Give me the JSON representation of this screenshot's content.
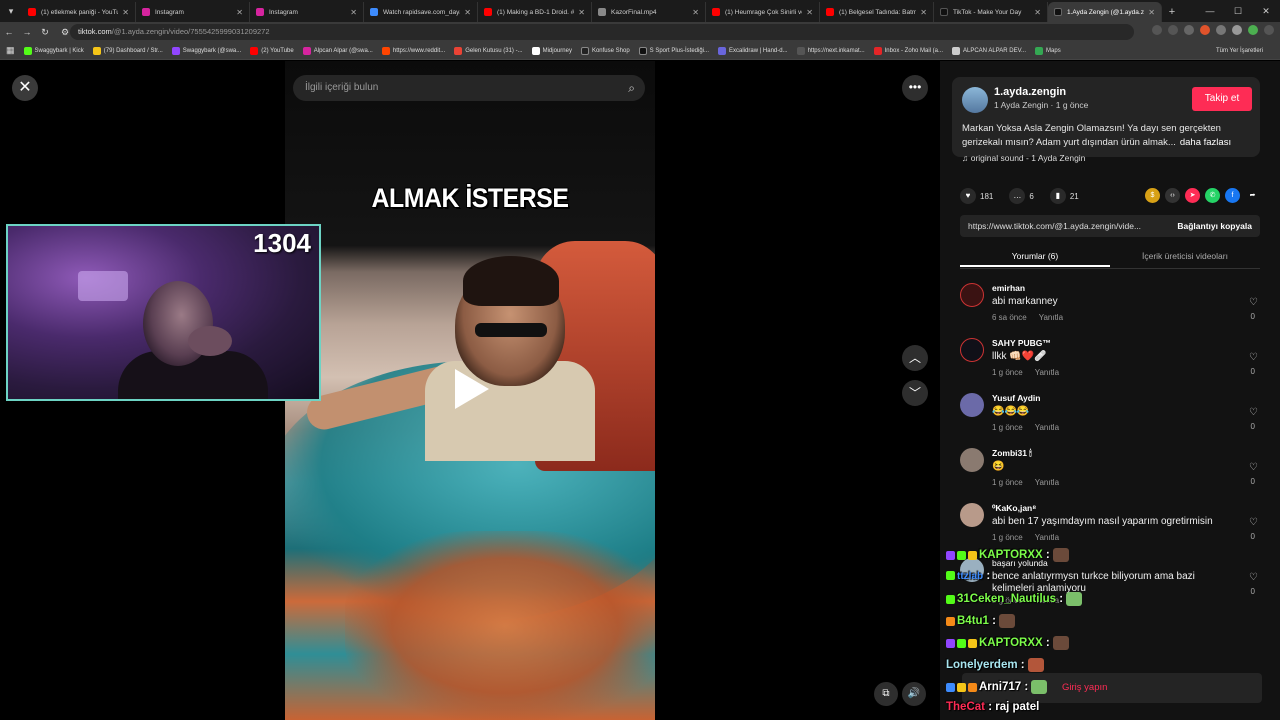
{
  "browser": {
    "tabs": [
      {
        "label": "(1) etlekmek paniği - YouTube",
        "color": "#ff0000",
        "active": false
      },
      {
        "label": "Instagram",
        "color": "#d6249f",
        "active": false
      },
      {
        "label": "Instagram",
        "color": "#d6249f",
        "active": false
      },
      {
        "label": "Watch rapidsave.com_dayanı...",
        "color": "#3d8bfd",
        "active": false
      },
      {
        "label": "(1) Making a BD-1 Droid. #sh...",
        "color": "#ff0000",
        "active": false
      },
      {
        "label": "KazorFinal.mp4",
        "color": "#888888",
        "active": false
      },
      {
        "label": "(1) Heumrage Çok Sinirli ve O...",
        "color": "#ff0000",
        "active": false
      },
      {
        "label": "(1) Belgesel Tadında: Batman...",
        "color": "#ff0000",
        "active": false
      },
      {
        "label": "TikTok - Make Your Day",
        "color": "#111111",
        "active": false
      },
      {
        "label": "1.Ayda Zengin (@1.ayda.zeng...",
        "color": "#111111",
        "active": true
      }
    ],
    "url_host": "tiktok.com",
    "url_path": "/@1.ayda.zengin/video/7555425999031209272",
    "bookmarks": [
      {
        "label": "Swaggybark | Kick",
        "color": "#53fc18"
      },
      {
        "label": "(79) Dashboard / Str...",
        "color": "#f5c518"
      },
      {
        "label": "Swaggybark (@swa...",
        "color": "#9146ff"
      },
      {
        "label": "(2) YouTube",
        "color": "#ff0000"
      },
      {
        "label": "Alpcan Alpar (@swa...",
        "color": "#d6249f"
      },
      {
        "label": "https://www.reddit...",
        "color": "#ff4500"
      },
      {
        "label": "Gelen Kutusu (31) -...",
        "color": "#ea4335"
      },
      {
        "label": "Midjourney",
        "color": "#ffffff"
      },
      {
        "label": "Konfuse Shop",
        "color": "#222222"
      },
      {
        "label": "S Sport Plus-İstediği...",
        "color": "#111111"
      },
      {
        "label": "Excalidraw | Hand-d...",
        "color": "#6965db"
      },
      {
        "label": "https://next.inkamat...",
        "color": "#555555"
      },
      {
        "label": "Inbox - Zoho Mail (a...",
        "color": "#e42527"
      },
      {
        "label": "ALPCAN ALPAR DEV...",
        "color": "#cccccc"
      },
      {
        "label": "Maps",
        "color": "#34a853"
      }
    ],
    "bookmarks_right": "Tüm Yer İşaretleri"
  },
  "video": {
    "search_placeholder": "İlgili içeriği bulun",
    "caption": "ALMAK İSTERSE"
  },
  "webcam": {
    "counter": "1304"
  },
  "info": {
    "username": "1.ayda.zengin",
    "subline": "1 Ayda Zengin · 1 g önce",
    "follow": "Takip et",
    "description": "Markan Yoksa Asla Zengin Olamazsın! Ya dayı sen gerçekten gerizekalı mısın? Adam yurt dışından ürün almak...",
    "more": "daha fazlası",
    "sound": "♫  original sound - 1 Ayda Zengin",
    "likes": "181",
    "comments": "6",
    "saves": "21",
    "link": "https://www.tiktok.com/@1.ayda.zengin/vide...",
    "copy_link": "Bağlantıyı kopyala",
    "tab_comments": "Yorumlar (6)",
    "tab_creator": "İçerik üreticisi videoları"
  },
  "comments": [
    {
      "name": "emirhan",
      "text": "abi markanney",
      "time": "6 sa önce",
      "reply": "Yanıtla",
      "likes": "0",
      "avatar": "#3a1212"
    },
    {
      "name": "SAHY PUBG™",
      "text": "llkk 👊🏻❤️🩹",
      "time": "1 g önce",
      "reply": "Yanıtla",
      "likes": "0",
      "avatar": "#101018"
    },
    {
      "name": "Yusuf Aydin",
      "text": "😂😂😂",
      "time": "1 g önce",
      "reply": "Yanıtla",
      "likes": "0",
      "avatar": "#6b6aa8"
    },
    {
      "name": "Zombi31 🕯",
      "text": "😆",
      "time": "1 g önce",
      "reply": "Yanıtla",
      "likes": "0",
      "avatar": "#8a7a70"
    },
    {
      "name": "⁰KaKo,jan⁸",
      "text": "abi ben 17 yaşımdayım nasıl yaparım ogretirmisin",
      "time": "1 g önce",
      "reply": "Yanıtla",
      "likes": "0",
      "avatar": "#b89a8a"
    },
    {
      "name": "başarı yolunda",
      "text": "bence anlatıyrmysn turkce biliyorum ama bazi kelimeleri anlamiyoru",
      "time": "1 g önce",
      "reply": "Yanıtla",
      "likes": "0",
      "avatar": "#9ab0c0"
    }
  ],
  "chat": [
    {
      "user": "KAPTORXX",
      "msg": ":",
      "color": "#7cfc4a"
    },
    {
      "user": "ttzlab",
      "msg": ":",
      "color": "#3d8bfd"
    },
    {
      "user": "31Ceken_Nautilus",
      "msg": ":",
      "color": "#7cfc4a"
    },
    {
      "user": "B4tu1",
      "msg": ":",
      "color": "#7cfc4a"
    },
    {
      "user": "KAPTORXX",
      "msg": ":",
      "color": "#7cfc4a"
    },
    {
      "user": "Lonelyerdem",
      "msg": ":",
      "color": "#a8e6f0"
    },
    {
      "user": "Arni717",
      "msg": ":",
      "color": "#ffffff"
    },
    {
      "user": "TheCat",
      "msg": ": raj patel",
      "color": "#fe2c55"
    }
  ],
  "login_prompt": "Giriş yapın"
}
